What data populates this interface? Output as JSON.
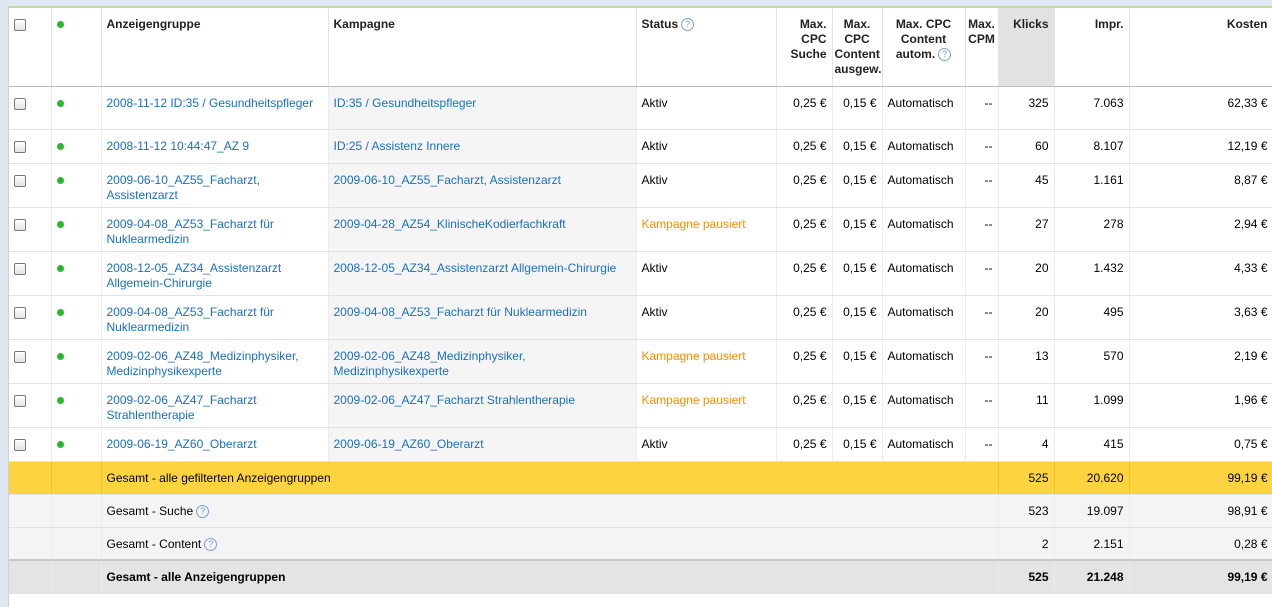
{
  "headers": {
    "anzeigengruppe": "Anzeigengruppe",
    "kampagne": "Kampagne",
    "status": "Status",
    "cpc_suche": [
      "Max.",
      "CPC",
      "Suche"
    ],
    "cpc_content": [
      "Max.",
      "CPC",
      "Content",
      "ausgew."
    ],
    "cpc_auto": [
      "Max. CPC",
      "Content",
      "autom."
    ],
    "cpm": [
      "Max.",
      "CPM"
    ],
    "klicks": "Klicks",
    "impr": "Impr.",
    "kosten": "Kosten",
    "help_glyph": "?"
  },
  "colors": {
    "link": "#1a6fc6",
    "paused": "#ff8c00",
    "active_dot": "#2db52d",
    "total_row": "#fdd440"
  },
  "rows": [
    {
      "gruppe": "2008-11-12 ID:35 / Gesundheitspfleger",
      "kampagne": "ID:35 / Gesundheitspfleger",
      "status": "Aktiv",
      "paused": false,
      "cpc_suche": "0,25 €",
      "cpc_content": "0,15 €",
      "cpc_auto": "Automatisch",
      "cpm": "--",
      "klicks": "325",
      "impr": "7.063",
      "kosten": "62,33 €"
    },
    {
      "gruppe": "2008-11-12 10:44:47_AZ 9",
      "kampagne": "ID:25 / Assistenz Innere",
      "status": "Aktiv",
      "paused": false,
      "cpc_suche": "0,25 €",
      "cpc_content": "0,15 €",
      "cpc_auto": "Automatisch",
      "cpm": "--",
      "klicks": "60",
      "impr": "8.107",
      "kosten": "12,19 €"
    },
    {
      "gruppe": "2009-06-10_AZ55_Facharzt, Assistenzarzt",
      "kampagne": "2009-06-10_AZ55_Facharzt, Assistenzarzt",
      "status": "Aktiv",
      "paused": false,
      "cpc_suche": "0,25 €",
      "cpc_content": "0,15 €",
      "cpc_auto": "Automatisch",
      "cpm": "--",
      "klicks": "45",
      "impr": "1.161",
      "kosten": "8,87 €"
    },
    {
      "gruppe": "2009-04-08_AZ53_Facharzt für Nuklearmedizin",
      "kampagne": "2009-04-28_AZ54_KlinischeKodierfachkraft",
      "status": "Kampagne pausiert",
      "paused": true,
      "cpc_suche": "0,25 €",
      "cpc_content": "0,15 €",
      "cpc_auto": "Automatisch",
      "cpm": "--",
      "klicks": "27",
      "impr": "278",
      "kosten": "2,94 €"
    },
    {
      "gruppe": "2008-12-05_AZ34_Assistenzarzt Allgemein-Chirurgie",
      "kampagne": "2008-12-05_AZ34_Assistenzarzt Allgemein-Chirurgie",
      "status": "Aktiv",
      "paused": false,
      "cpc_suche": "0,25 €",
      "cpc_content": "0,15 €",
      "cpc_auto": "Automatisch",
      "cpm": "--",
      "klicks": "20",
      "impr": "1.432",
      "kosten": "4,33 €"
    },
    {
      "gruppe": "2009-04-08_AZ53_Facharzt für Nuklearmedizin",
      "kampagne": "2009-04-08_AZ53_Facharzt für Nuklearmedizin",
      "status": "Aktiv",
      "paused": false,
      "cpc_suche": "0,25 €",
      "cpc_content": "0,15 €",
      "cpc_auto": "Automatisch",
      "cpm": "--",
      "klicks": "20",
      "impr": "495",
      "kosten": "3,63 €"
    },
    {
      "gruppe": "2009-02-06_AZ48_Medizinphysiker, Medizinphysikexperte",
      "kampagne": "2009-02-06_AZ48_Medizinphysiker, Medizinphysikexperte",
      "status": "Kampagne pausiert",
      "paused": true,
      "cpc_suche": "0,25 €",
      "cpc_content": "0,15 €",
      "cpc_auto": "Automatisch",
      "cpm": "--",
      "klicks": "13",
      "impr": "570",
      "kosten": "2,19 €"
    },
    {
      "gruppe": "2009-02-06_AZ47_Facharzt Strahlentherapie",
      "kampagne": "2009-02-06_AZ47_Facharzt Strahlentherapie",
      "status": "Kampagne pausiert",
      "paused": true,
      "cpc_suche": "0,25 €",
      "cpc_content": "0,15 €",
      "cpc_auto": "Automatisch",
      "cpm": "--",
      "klicks": "11",
      "impr": "1.099",
      "kosten": "1,96 €"
    },
    {
      "gruppe": "2009-06-19_AZ60_Oberarzt",
      "kampagne": "2009-06-19_AZ60_Oberarzt",
      "status": "Aktiv",
      "paused": false,
      "cpc_suche": "0,25 €",
      "cpc_content": "0,15 €",
      "cpc_auto": "Automatisch",
      "cpm": "--",
      "klicks": "4",
      "impr": "415",
      "kosten": "0,75 €"
    }
  ],
  "totals": [
    {
      "label": "Gesamt - alle gefilterten Anzeigengruppen",
      "help": false,
      "style": "yellow",
      "klicks": "525",
      "impr": "20.620",
      "kosten": "99,19 €"
    },
    {
      "label": "Gesamt - Suche",
      "help": true,
      "style": "grey",
      "klicks": "523",
      "impr": "19.097",
      "kosten": "98,91 €"
    },
    {
      "label": "Gesamt - Content",
      "help": true,
      "style": "grey",
      "klicks": "2",
      "impr": "2.151",
      "kosten": "0,28 €"
    },
    {
      "label": "Gesamt - alle Anzeigengruppen",
      "help": false,
      "style": "dark",
      "klicks": "525",
      "impr": "21.248",
      "kosten": "99,19 €"
    }
  ]
}
